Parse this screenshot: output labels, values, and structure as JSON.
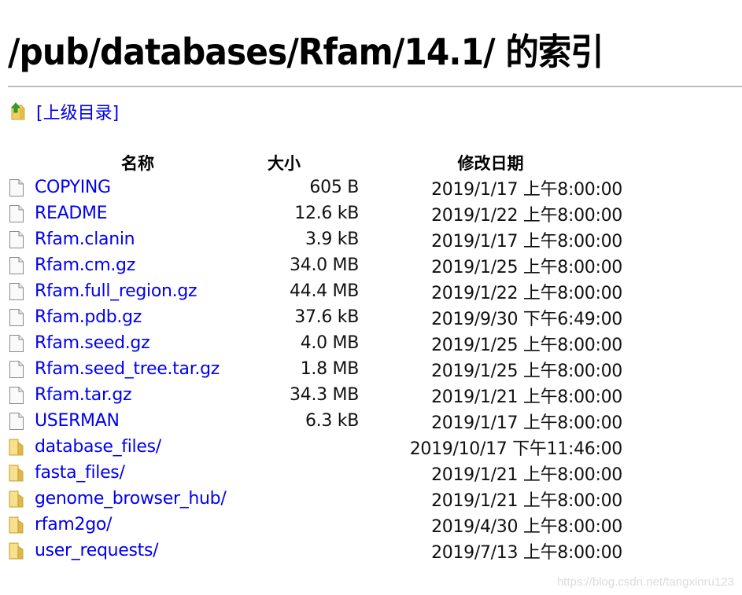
{
  "page": {
    "title": "/pub/databases/Rfam/14.1/ 的索引",
    "parent_link": {
      "label": "[上级目录]",
      "icon": "folder-up-icon"
    }
  },
  "table": {
    "headers": {
      "name": "名称",
      "size": "大小",
      "modified": "修改日期"
    },
    "rows": [
      {
        "type": "file",
        "icon": "file-icon",
        "name": "COPYING",
        "size": "605 B",
        "modified": "2019/1/17 上午8:00:00"
      },
      {
        "type": "file",
        "icon": "file-icon",
        "name": "README",
        "size": "12.6 kB",
        "modified": "2019/1/22 上午8:00:00"
      },
      {
        "type": "file",
        "icon": "file-icon",
        "name": "Rfam.clanin",
        "size": "3.9 kB",
        "modified": "2019/1/17 上午8:00:00"
      },
      {
        "type": "file",
        "icon": "file-icon",
        "name": "Rfam.cm.gz",
        "size": "34.0 MB",
        "modified": "2019/1/25 上午8:00:00"
      },
      {
        "type": "file",
        "icon": "file-icon",
        "name": "Rfam.full_region.gz",
        "size": "44.4 MB",
        "modified": "2019/1/22 上午8:00:00"
      },
      {
        "type": "file",
        "icon": "file-icon",
        "name": "Rfam.pdb.gz",
        "size": "37.6 kB",
        "modified": "2019/9/30 下午6:49:00"
      },
      {
        "type": "file",
        "icon": "file-icon",
        "name": "Rfam.seed.gz",
        "size": "4.0 MB",
        "modified": "2019/1/25 上午8:00:00"
      },
      {
        "type": "file",
        "icon": "file-icon",
        "name": "Rfam.seed_tree.tar.gz",
        "size": "1.8 MB",
        "modified": "2019/1/25 上午8:00:00"
      },
      {
        "type": "file",
        "icon": "file-icon",
        "name": "Rfam.tar.gz",
        "size": "34.3 MB",
        "modified": "2019/1/21 上午8:00:00"
      },
      {
        "type": "file",
        "icon": "file-icon",
        "name": "USERMAN",
        "size": "6.3 kB",
        "modified": "2019/1/17 上午8:00:00"
      },
      {
        "type": "folder",
        "icon": "folder-icon",
        "name": "database_files/",
        "size": "",
        "modified": "2019/10/17 下午11:46:00"
      },
      {
        "type": "folder",
        "icon": "folder-icon",
        "name": "fasta_files/",
        "size": "",
        "modified": "2019/1/21 上午8:00:00"
      },
      {
        "type": "folder",
        "icon": "folder-icon",
        "name": "genome_browser_hub/",
        "size": "",
        "modified": "2019/1/21 上午8:00:00"
      },
      {
        "type": "folder",
        "icon": "folder-icon",
        "name": "rfam2go/",
        "size": "",
        "modified": "2019/4/30 上午8:00:00"
      },
      {
        "type": "folder",
        "icon": "folder-icon",
        "name": "user_requests/",
        "size": "",
        "modified": "2019/7/13 上午8:00:00"
      }
    ]
  },
  "watermark": "https://blog.csdn.net/tangxinru123",
  "colors": {
    "link": "#0000ee",
    "divider": "#bdbdbd",
    "folder": "#f2d26a",
    "up_arrow": "#2aa52a"
  }
}
